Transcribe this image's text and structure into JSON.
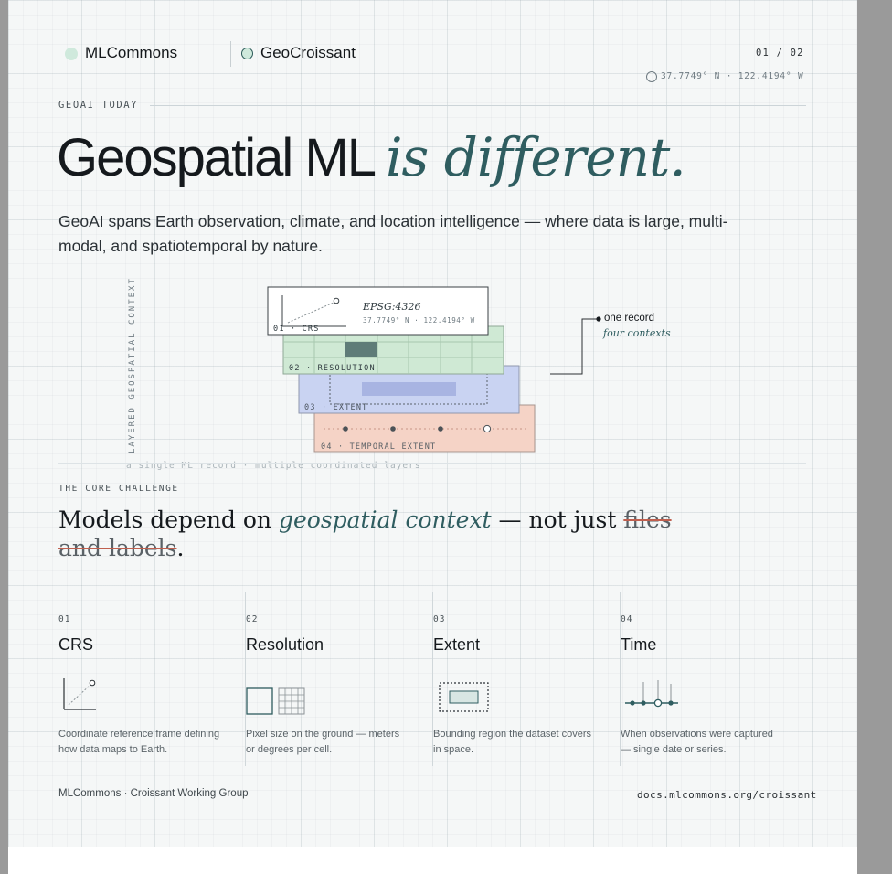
{
  "header": {
    "brand_primary": "MLCommons",
    "brand_secondary": "GeoCroissant",
    "page_number": "01 / 02",
    "coordinates": "37.7749° N · 122.4194° W"
  },
  "hero": {
    "eyebrow": "GEOAI TODAY",
    "headline_main": "Geospatial ML",
    "headline_accent": "is different.",
    "lede": "GeoAI spans Earth observation, climate, and location intelligence — where data is large, multi-modal, and spatiotemporal by nature."
  },
  "diagram": {
    "vertical_label": "LAYERED GEOSPATIAL CONTEXT",
    "caption": "a single ML record · multiple coordinated layers",
    "crs_code": "EPSG:4326",
    "crs_coords": "37.7749° N · 122.4194° W",
    "layers": [
      {
        "label": "01 · CRS",
        "color": "#ffffff"
      },
      {
        "label": "02 · RESOLUTION",
        "color": "#cfe9d4"
      },
      {
        "label": "03 · EXTENT",
        "color": "#c9d3f2"
      },
      {
        "label": "04 · TEMPORAL EXTENT",
        "color": "#f5d3c6"
      }
    ],
    "callout_main": "one record",
    "callout_sub": "four contexts"
  },
  "challenge": {
    "eyebrow": "THE CORE CHALLENGE",
    "text_before": "Models depend on ",
    "text_accent": "geospatial context",
    "text_middle": " — not just ",
    "text_strike": "files and labels",
    "text_end": "."
  },
  "columns": [
    {
      "num": "01",
      "title": "CRS",
      "icon": "crs-icon",
      "desc": "Coordinate reference frame defining how data maps to Earth."
    },
    {
      "num": "02",
      "title": "Resolution",
      "icon": "resolution-icon",
      "desc": "Pixel size on the ground — meters or degrees per cell."
    },
    {
      "num": "03",
      "title": "Extent",
      "icon": "extent-icon",
      "desc": "Bounding region the dataset covers in space."
    },
    {
      "num": "04",
      "title": "Time",
      "icon": "time-icon",
      "desc": "When observations were captured — single date or series."
    }
  ],
  "footer": {
    "left": "MLCommons · Croissant Working Group",
    "right": "docs.mlcommons.org/croissant"
  },
  "colors": {
    "accent": "#2f5d60",
    "strike": "#c0604f",
    "brand_dot": "#cfe9dc"
  }
}
